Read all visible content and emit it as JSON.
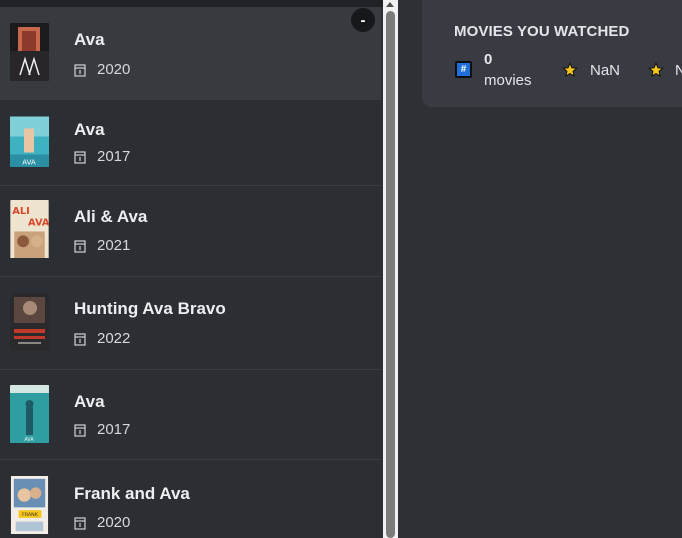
{
  "results": [
    {
      "title": "Ava",
      "year": "2020",
      "active": true
    },
    {
      "title": "Ava",
      "year": "2017",
      "active": false
    },
    {
      "title": "Ali & Ava",
      "year": "2021",
      "active": false
    },
    {
      "title": "Hunting Ava Bravo",
      "year": "2022",
      "active": false
    },
    {
      "title": "Ava",
      "year": "2017",
      "active": false
    },
    {
      "title": "Frank and Ava",
      "year": "2020",
      "active": false
    }
  ],
  "collapse_button": {
    "label": "-"
  },
  "stats": {
    "title": "MOVIES YOU WATCHED",
    "count_value": "0",
    "count_unit": "movies",
    "avg_rating": "NaN",
    "second_rating": "N"
  },
  "colors": {
    "background": "#2d3035",
    "list_background": "#2b2e33",
    "active_row": "#373b40",
    "card_background": "#383c42",
    "hash_icon": "#1e6fd9",
    "star": "#f5c518"
  }
}
